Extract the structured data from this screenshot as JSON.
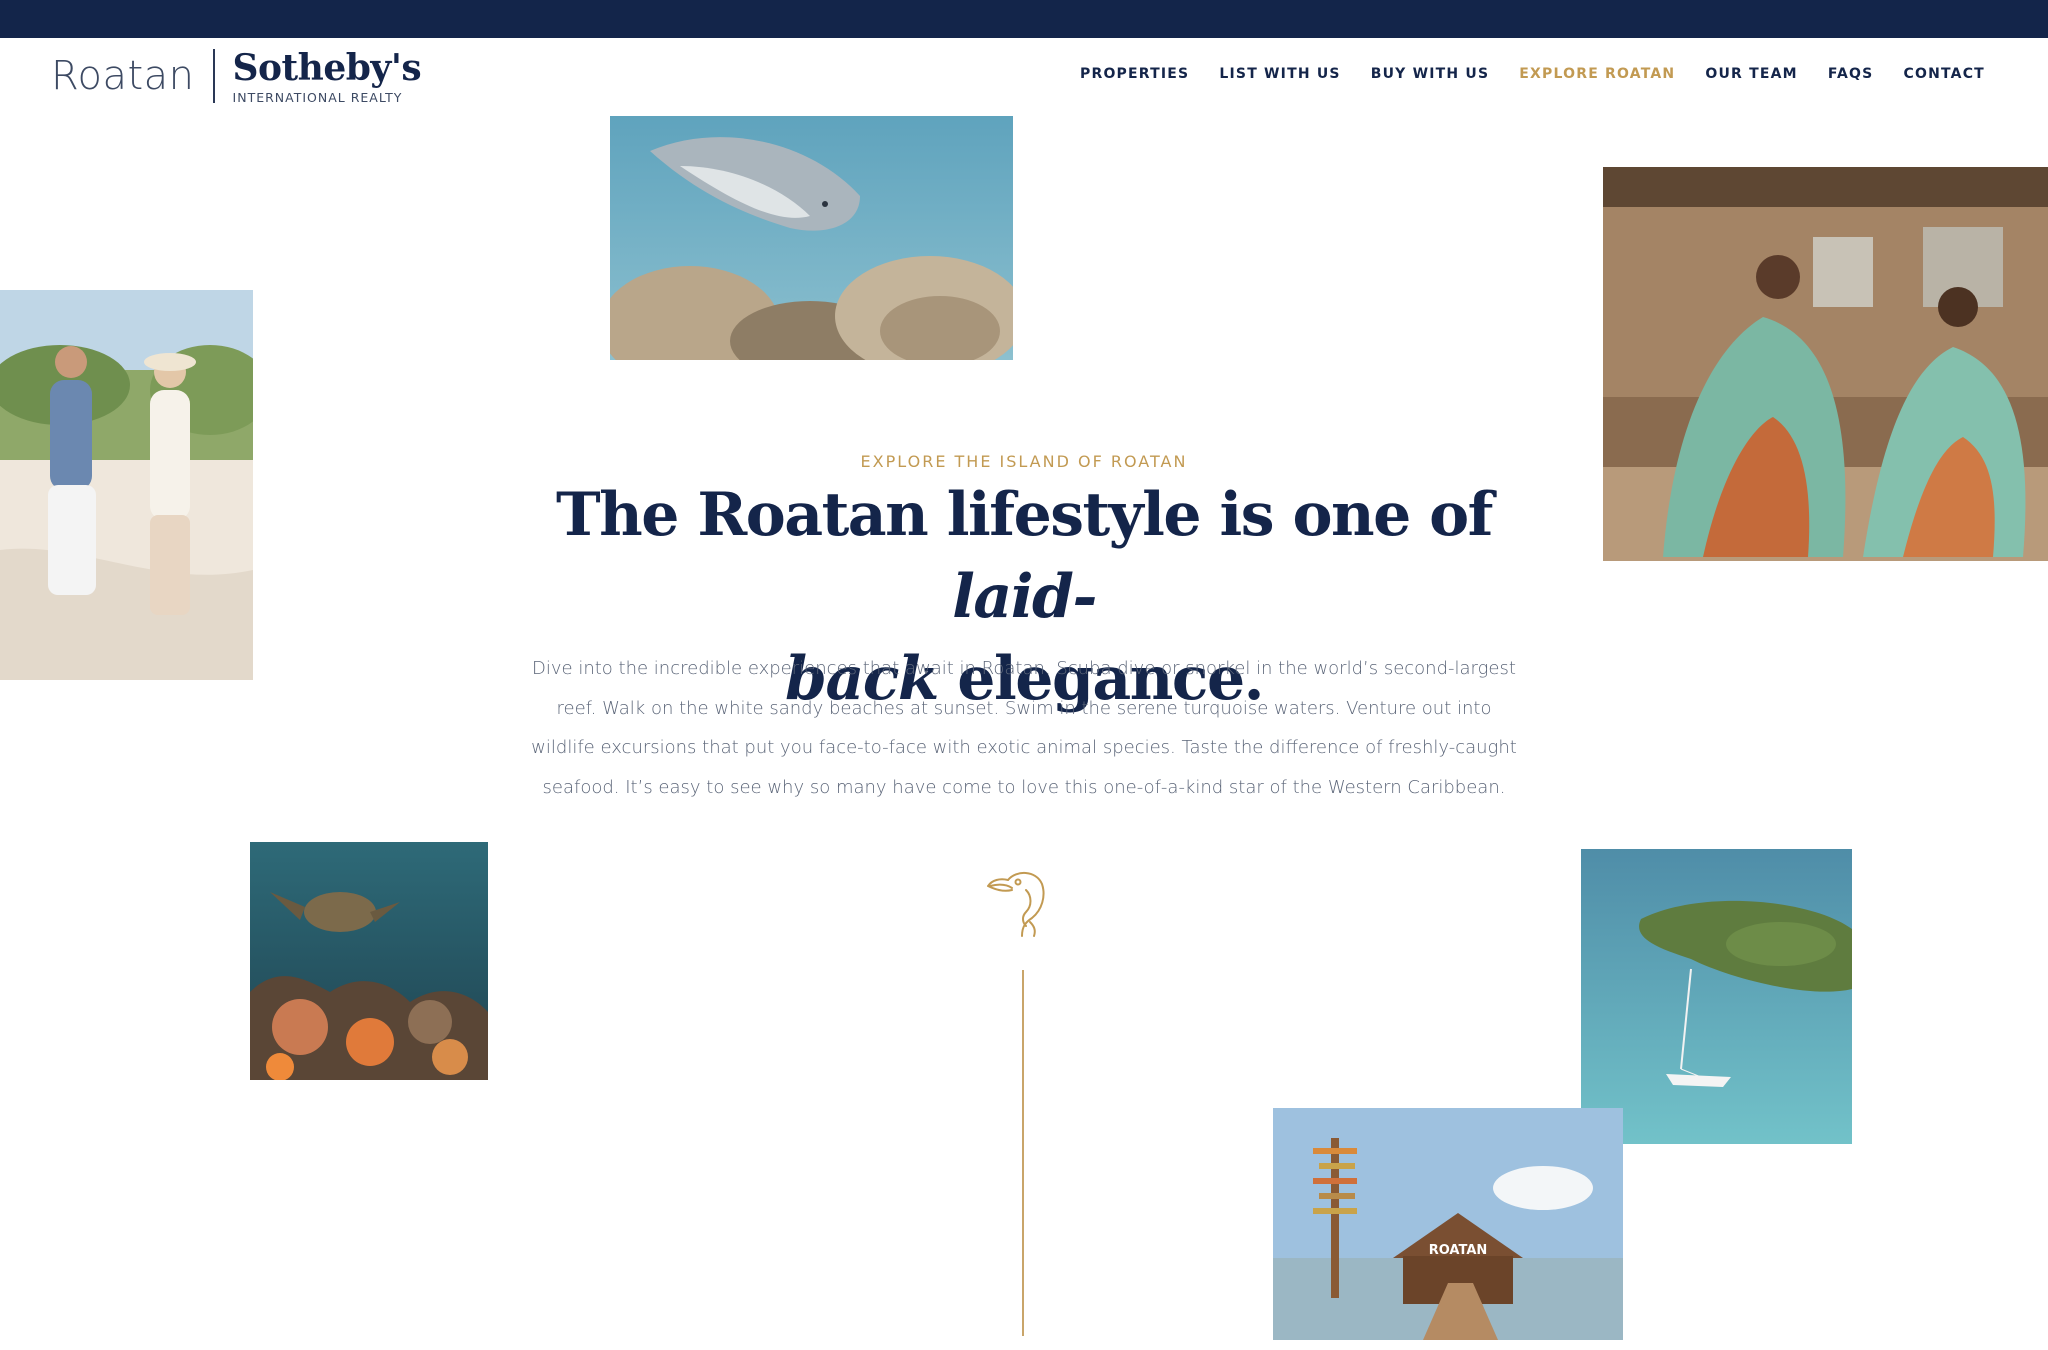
{
  "header": {
    "logo_primary": "Roatan",
    "logo_brand": "Sotheby's",
    "logo_sub": "INTERNATIONAL REALTY"
  },
  "nav": {
    "items": [
      {
        "label": "PROPERTIES"
      },
      {
        "label": "LIST WITH US"
      },
      {
        "label": "BUY WITH US"
      },
      {
        "label": "EXPLORE ROATAN",
        "active": true
      },
      {
        "label": "OUR TEAM"
      },
      {
        "label": "FAQS"
      },
      {
        "label": "CONTACT"
      }
    ]
  },
  "hero": {
    "kicker": "EXPLORE THE ISLAND OF ROATAN",
    "headline_start": "The Roatan lifestyle is one of ",
    "headline_italic_1": "laid-",
    "headline_italic_2": "back",
    "headline_end": " elegance.",
    "intro": "Dive into the incredible experiences that await in Roatan. Scuba dive or snorkel in the world’s second-largest reef. Walk on the white sandy beaches at sunset. Swim in the serene turquoise waters. Venture out into wildlife excursions that put you face-to-face with exotic animal species. Taste the difference of freshly-caught seafood. It’s easy to see why so many have come to love this one-of-a-kind star of the Western Caribbean."
  },
  "photos": {
    "pier_sign": "ROATAN"
  },
  "colors": {
    "navy": "#13254a",
    "gold": "#c29a52",
    "body_text": "#5b6578"
  }
}
